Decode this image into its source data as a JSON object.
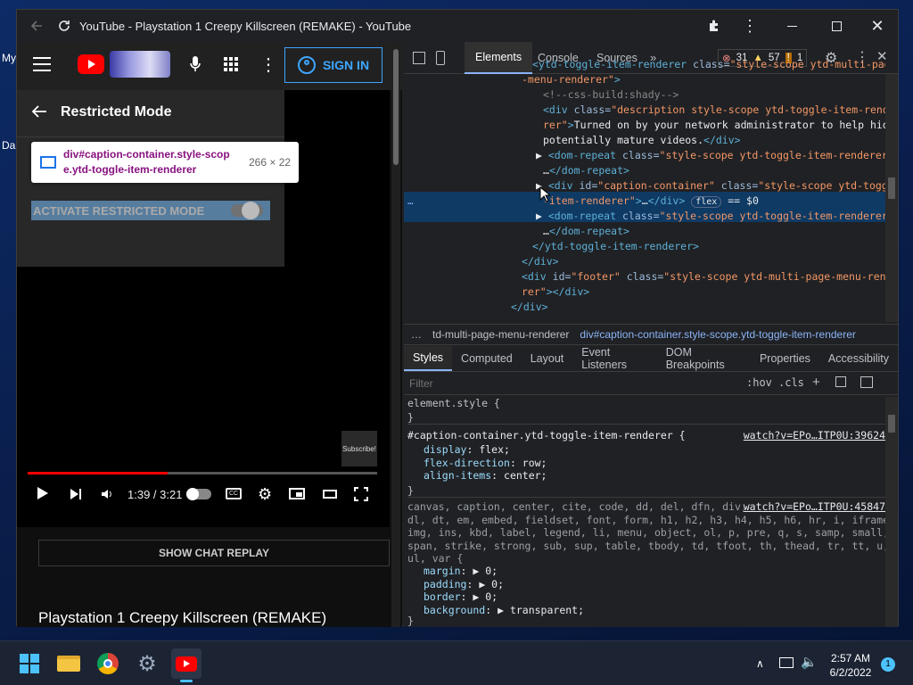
{
  "desktop": {
    "icon1": "My",
    "icon2": "Da"
  },
  "window": {
    "title": "YouTube - Playstation 1 Creepy Killscreen (REMAKE) - YouTube"
  },
  "youtube": {
    "sign_in": "SIGN IN",
    "restricted_title": "Restricted Mode",
    "tooltip_selector": "div#caption-container.style-scope.ytd-toggle-item-renderer",
    "tooltip_size": "266 × 22",
    "activate_label": "ACTIVATE RESTRICTED MODE",
    "subscribe_label": "Subscribe!",
    "time": "1:39 / 3:21",
    "progress_fraction": 0.4,
    "chat_replay": "SHOW CHAT REPLAY",
    "video_title": "Playstation 1 Creepy Killscreen (REMAKE)"
  },
  "devtools": {
    "tabs": [
      "Elements",
      "Console",
      "Sources"
    ],
    "errors": "31",
    "warnings": "57",
    "issues": "1",
    "dom_lines": [
      {
        "html": "<span class='tag'>&lt;ytd-toggle-item-renderer</span> <span class='attr'>class=</span><span class='val'>\"style-scope ytd-multi-page</span>"
      },
      {
        "html": "<span class='val'>-menu-renderer\"</span><span class='tag'>&gt;</span>"
      },
      {
        "html": "<span class='cm'>&lt;!--css-build:shady--&gt;</span>"
      },
      {
        "html": "<span class='tag'>&lt;div</span> <span class='attr'>class=</span><span class='val'>\"description style-scope ytd-toggle-item-rende</span>"
      },
      {
        "html": "<span class='val'>rer\"</span><span class='tag'>&gt;</span><span class='txt'>Turned on by your network administrator to help hide</span>"
      },
      {
        "html": "<span class='txt'>potentially mature videos.</span><span class='tag'>&lt;/div&gt;</span>"
      },
      {
        "html": "▶ <span class='tag'>&lt;dom-repeat</span> <span class='attr'>class=</span><span class='val'>\"style-scope ytd-toggle-item-renderer\"</span><span class='tag'>&gt;</span>"
      },
      {
        "html": "<span class='txt'>…</span><span class='tag'>&lt;/dom-repeat&gt;</span>"
      },
      {
        "html": "▶ <span class='tag'>&lt;div</span> <span class='attr'>id=</span><span class='val'>\"caption-container\"</span> <span class='attr'>class=</span><span class='val'>\"style-scope ytd-toggle</span>"
      },
      {
        "html": "<span class='val'>-item-renderer\"</span><span class='tag'>&gt;</span><span class='txt'>…</span><span class='tag'>&lt;/div&gt;</span> <span style='border:1px solid #5a6a8a;border-radius:8px;padding:0 4px;font-size:10px'>flex</span> <span class='txt'>== $0</span>"
      },
      {
        "html": "▶ <span class='tag'>&lt;dom-repeat</span> <span class='attr'>class=</span><span class='val'>\"style-scope ytd-toggle-item-renderer\"</span><span class='tag'>&gt;</span>"
      },
      {
        "html": "<span class='txt'>…</span><span class='tag'>&lt;/dom-repeat&gt;</span>"
      },
      {
        "html": "<span class='tag'>&lt;/ytd-toggle-item-renderer&gt;</span>"
      },
      {
        "html": "<span class='tag'>&lt;/div&gt;</span>"
      },
      {
        "html": "<span class='tag'>&lt;div</span> <span class='attr'>id=</span><span class='val'>\"footer\"</span> <span class='attr'>class=</span><span class='val'>\"style-scope ytd-multi-page-menu-rende</span>"
      },
      {
        "html": "<span class='val'>rer\"</span><span class='tag'>&gt;&lt;/div&gt;</span>"
      },
      {
        "html": "<span class='tag'>&lt;/div&gt;</span>"
      }
    ],
    "breadcrumb1": "td-multi-page-menu-renderer",
    "breadcrumb2": "div#caption-container.style-scope.ytd-toggle-item-renderer",
    "styles_tabs": [
      "Styles",
      "Computed",
      "Layout",
      "Event Listeners",
      "DOM Breakpoints",
      "Properties",
      "Accessibility"
    ],
    "filter_placeholder": "Filter",
    "hov": ":hov",
    "cls": ".cls",
    "element_style": "element.style {",
    "rule1_selector": "#caption-container.ytd-toggle-item-renderer {",
    "rule1_source": "watch?v=EPo…ITP0U:39624",
    "rule1_props": [
      {
        "name": "display",
        "value": "flex;"
      },
      {
        "name": "flex-direction",
        "value": "row;"
      },
      {
        "name": "align-items",
        "value": "center;"
      }
    ],
    "rule2_selectors": [
      "canvas, caption, center, cite, code, dd, del, dfn, div,",
      "dl, dt, em, embed, fieldset, font, form, h1, h2, h3, h4, h5, h6, hr, i, iframe,",
      "img, ins, kbd, label, legend, li, menu, object, ol, p, pre, q, s, samp, small,",
      "span, strike, strong, sub, sup, table, tbody, td, tfoot, th, thead, tr, tt, u,",
      "ul, var {"
    ],
    "rule2_source": "watch?v=EPo…ITP0U:45847",
    "rule2_props": [
      {
        "name": "margin",
        "value": "▶ 0;"
      },
      {
        "name": "padding",
        "value": "▶ 0;"
      },
      {
        "name": "border",
        "value": "▶ 0;"
      },
      {
        "name": "background",
        "value": "▶ transparent;"
      }
    ]
  },
  "taskbar": {
    "time": "2:57 AM",
    "date": "6/2/2022",
    "notif": "1"
  },
  "colors": {
    "youtube_red": "#ff0000",
    "accent": "#3ea6ff",
    "devtools_select": "#0f3a64"
  }
}
